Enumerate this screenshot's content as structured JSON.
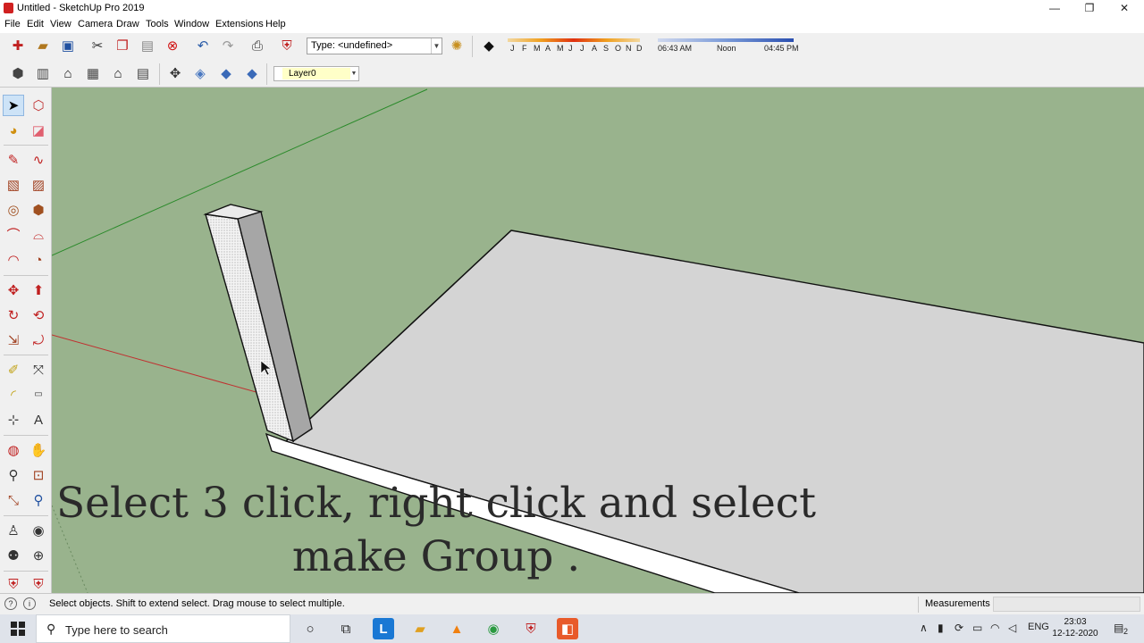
{
  "window": {
    "title": "Untitled - SketchUp Pro 2019",
    "minimize": "—",
    "restore": "❐",
    "close": "✕"
  },
  "menu": [
    "File",
    "Edit",
    "View",
    "Camera",
    "Draw",
    "Tools",
    "Window",
    "Extensions",
    "Help"
  ],
  "toolbar": {
    "type_select": "Type: <undefined>",
    "months": [
      "J",
      "F",
      "M",
      "A",
      "M",
      "J",
      "J",
      "A",
      "S",
      "O",
      "N",
      "D"
    ],
    "time_start": "06:43 AM",
    "time_mid": "Noon",
    "time_end": "04:45 PM",
    "layer": "Layer0"
  },
  "viewport": {
    "caption_line1": "Select 3 click, right click and select",
    "caption_line2": "make Group ."
  },
  "statusbar": {
    "hint": "Select objects. Shift to extend select. Drag mouse to select multiple.",
    "measurements_label": "Measurements",
    "measurements_value": ""
  },
  "taskbar": {
    "search_placeholder": "Type here to search",
    "language": "ENG",
    "time": "23:03",
    "date": "12-12-2020",
    "notification_count": "2"
  },
  "colors": {
    "viewport_bg": "#99b38d",
    "ground": "#d3d3d3",
    "accent": "#d02020"
  }
}
